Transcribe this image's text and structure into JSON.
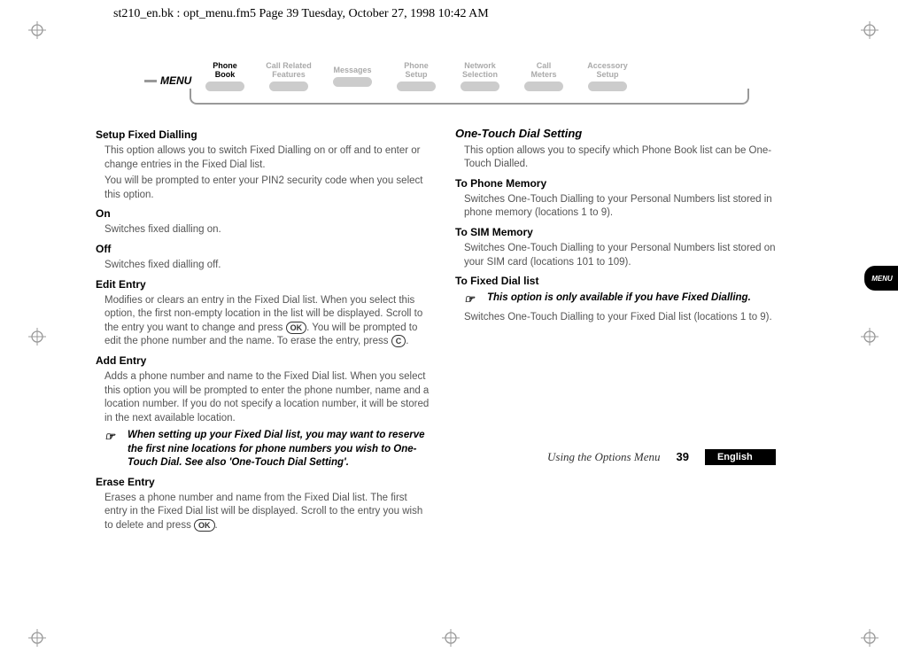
{
  "header_meta": "st210_en.bk : opt_menu.fm5  Page 39  Tuesday, October 27, 1998  10:42 AM",
  "menu_label": "MENU",
  "menu_tabs": [
    {
      "line1": "Phone",
      "line2": "Book",
      "active": true
    },
    {
      "line1": "Call Related",
      "line2": "Features",
      "active": false
    },
    {
      "line1": "Messages",
      "line2": "",
      "active": false
    },
    {
      "line1": "Phone",
      "line2": "Setup",
      "active": false
    },
    {
      "line1": "Network",
      "line2": "Selection",
      "active": false
    },
    {
      "line1": "Call",
      "line2": "Meters",
      "active": false
    },
    {
      "line1": "Accessory",
      "line2": "Setup",
      "active": false
    }
  ],
  "left": {
    "h2": "Setup Fixed Dialling",
    "p1": "This option allows you to switch Fixed Dialling on or off and to enter or change entries in the Fixed Dial list.",
    "p2": "You will be prompted to enter your PIN2 security code when you select this option.",
    "on_h": "On",
    "on_p": "Switches fixed dialling on.",
    "off_h": "Off",
    "off_p": "Switches fixed dialling off.",
    "edit_h": "Edit Entry",
    "edit_p1a": "Modifies or clears an entry in the Fixed Dial list. When you select this option, the first non-empty location in the list will be displayed. Scroll to the entry you want to change and press ",
    "edit_p1b": ". You will be prompted to edit the phone number and the name. To erase the entry, press ",
    "edit_p1c": ".",
    "add_h": "Add Entry",
    "add_p": "Adds a phone number and name to the Fixed Dial list. When you select this option you will be prompted to enter the phone number, name and a location number. If you do not specify a location number, it will be stored in the next available location.",
    "note1": "When setting up your Fixed Dial list, you may want to reserve the first nine locations for phone numbers you wish to One-Touch Dial. See also 'One-Touch Dial Setting'.",
    "erase_h": "Erase Entry",
    "erase_p_a": "Erases a phone number and name from the Fixed Dial list. The first entry in the Fixed Dial list will be displayed. Scroll to the entry you wish to delete and press ",
    "erase_p_b": "."
  },
  "right": {
    "h2": "One-Touch Dial Setting",
    "p1": "This option allows you to specify which Phone Book list can be One-Touch Dialled.",
    "pm_h": "To Phone Memory",
    "pm_p": "Switches One-Touch Dialling to your Personal Numbers list stored in phone memory (locations 1 to 9).",
    "sm_h": "To SIM Memory",
    "sm_p": "Switches One-Touch Dialling to your Personal Numbers list stored on your SIM card (locations 101 to 109).",
    "fd_h": "To Fixed Dial list",
    "note2": "This option is only available if you have Fixed Dialling.",
    "fd_p": "Switches One-Touch Dialling to your Fixed Dial list (locations 1 to 9)."
  },
  "keys": {
    "ok": "OK",
    "c": "C"
  },
  "side_menu": "MENU",
  "footer": {
    "running": "Using the Options Menu",
    "page": "39",
    "lang": "English"
  }
}
